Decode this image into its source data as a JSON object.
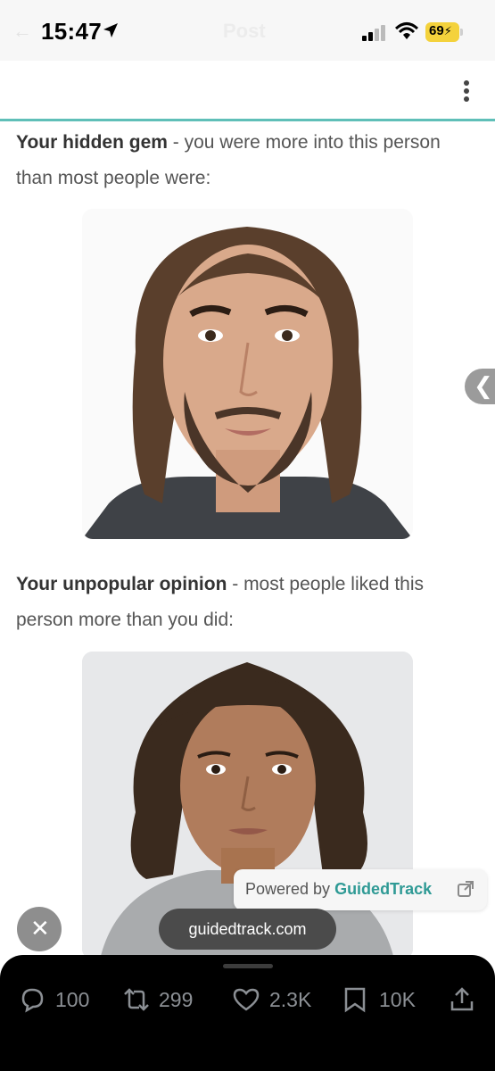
{
  "status_bar": {
    "time": "15:47",
    "ghost_title": "Post",
    "battery": "69"
  },
  "content": {
    "gem_heading": "Your hidden gem",
    "gem_text": " - you were more into this person than most people were:",
    "unpop_heading": "Your unpopular opinion",
    "unpop_text": " - most people liked this person more than you did:"
  },
  "side_tab": {
    "glyph": "❮"
  },
  "overlay": {
    "powered_prefix": "Powered by ",
    "powered_brand": "GuidedTrack",
    "url": "guidedtrack.com",
    "close_glyph": "✕"
  },
  "actions": {
    "replies": "100",
    "retweets": "299",
    "likes": "2.3K",
    "bookmarks": "10K"
  },
  "colors": {
    "accent_teal": "#5fbfb8",
    "brand_teal": "#2f9a95",
    "battery_yellow": "#f4d23c"
  }
}
